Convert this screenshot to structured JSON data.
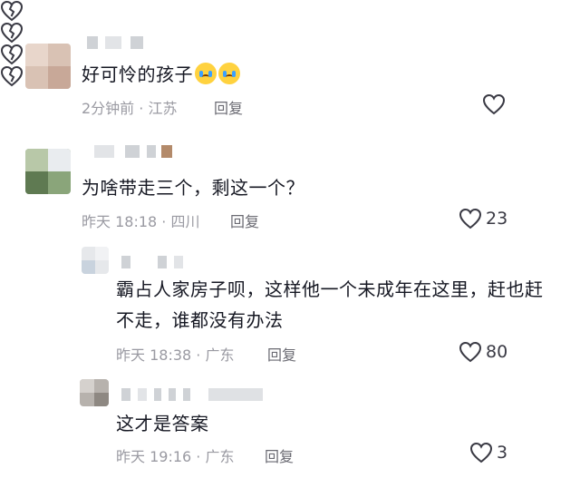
{
  "comments": [
    {
      "text": "好可怜的孩子",
      "emoji": [
        "crying-face",
        "crying-face"
      ],
      "meta": "2分钟前 · 江苏",
      "reply_label": "回复",
      "like_count": ""
    },
    {
      "text": "为啥带走三个，剩这一个？",
      "meta": "昨天 18:18 · 四川",
      "reply_label": "回复",
      "like_count": "23"
    },
    {
      "text": "霸占人家房子呗，这样他一个未成年在这里，赶也赶不走，谁都没有办法",
      "meta": "昨天 18:38 · 广东",
      "reply_label": "回复",
      "like_count": "80"
    },
    {
      "text": "这才是答案",
      "meta": "昨天 19:16 · 广东",
      "reply_label": "回复",
      "like_count": "3"
    }
  ],
  "colors": {
    "text": "#161823",
    "meta": "#9a9aa2",
    "icon": "#3a3a44"
  },
  "icons": {
    "like": "heart-outline-icon",
    "dislike": "broken-heart-icon"
  }
}
